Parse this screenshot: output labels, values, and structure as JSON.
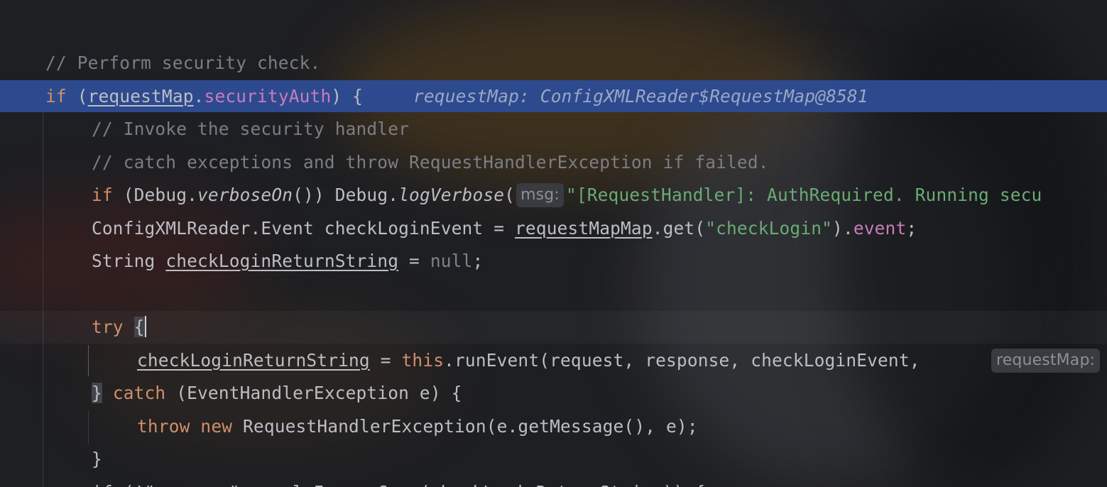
{
  "editor": {
    "lines": {
      "comment_security": "// Perform security check.",
      "exec_line": {
        "if_kw": "if",
        "open_paren": " (",
        "var": "requestMap",
        "dot": ".",
        "field": "securityAuth",
        "close": ") {",
        "inline_value": "requestMap: ConfigXMLReader$RequestMap@8581"
      },
      "comment_invoke": "// Invoke the security handler",
      "comment_catch": "// catch exceptions and throw RequestHandlerException if failed.",
      "debug_line": {
        "if_kw": "if",
        "part1": " (Debug.",
        "verbose_on": "verboseOn",
        "part2": "()) Debug.",
        "log_verbose": "logVerbose",
        "part3": "(",
        "hint": "msg:",
        "string": "\"[RequestHandler]: AuthRequired. Running secu"
      },
      "event_line": {
        "part1": "ConfigXMLReader.Event checkLoginEvent = ",
        "var": "requestMapMap",
        "part2": ".get(",
        "string": "\"checkLogin\"",
        "part3": ").",
        "field": "event",
        "part4": ";"
      },
      "string_line": {
        "part1": "String ",
        "var": "checkLoginReturnString",
        "part2": " = ",
        "null_kw": "null",
        "part3": ";"
      },
      "try_line": {
        "kw": "try",
        "space": " ",
        "brace": "{"
      },
      "run_event_line": {
        "var": "checkLoginReturnString",
        "part1": " = ",
        "this_kw": "this",
        "part2": ".runEvent(request, response, checkLoginEvent, ",
        "hint": "requestMap:"
      },
      "catch_line": {
        "brace": "}",
        "space": " ",
        "catch_kw": "catch",
        "rest": " (EventHandlerException e) {"
      },
      "throw_line": {
        "throw_kw": "throw",
        "space1": " ",
        "new_kw": "new",
        "rest": " RequestHandlerException(e.getMessage(), e);"
      },
      "close_brace": "}",
      "partial_bottom": "if (!\"success\".equalsIgnoreCase(checkLoginReturnString)) {"
    }
  },
  "colors": {
    "background": "#1e1f22",
    "execution_line": "#2e4a8e",
    "keyword": "#cf8e6d",
    "field": "#c77dbb",
    "string": "#6aab73",
    "comment": "#7a7e85"
  }
}
